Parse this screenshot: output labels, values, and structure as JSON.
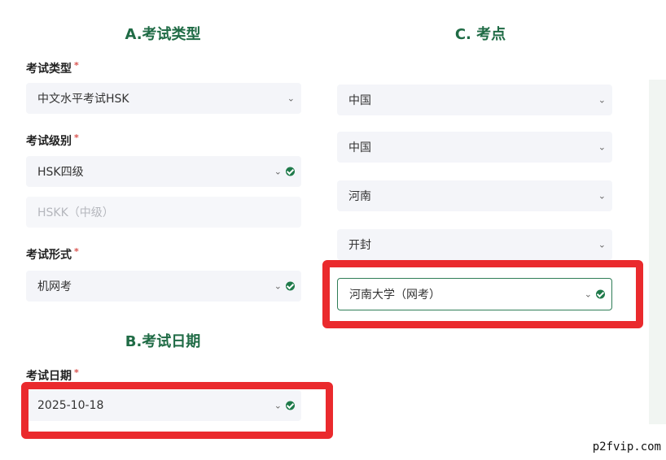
{
  "section_a": {
    "title": "A.考试类型",
    "exam_type": {
      "label": "考试类型",
      "required": "*",
      "value": "中文水平考试HSK"
    },
    "exam_level": {
      "label": "考试级别",
      "required": "*",
      "value": "HSK四级",
      "sub_value": "HSKK（中级）"
    },
    "exam_format": {
      "label": "考试形式",
      "required": "*",
      "value": "机网考"
    }
  },
  "section_b": {
    "title": "B.考试日期",
    "exam_date": {
      "label": "考试日期",
      "required": "*",
      "value": "2025-10-18"
    }
  },
  "section_c": {
    "title": "C. 考点",
    "country": "中国",
    "region": "中国",
    "province": "河南",
    "city": "开封",
    "center": "河南大学（网考）"
  },
  "watermark": "p2fvip.com",
  "colors": {
    "accent": "#1f6b45",
    "highlight": "#ea2a2d",
    "required": "#d9534f"
  }
}
